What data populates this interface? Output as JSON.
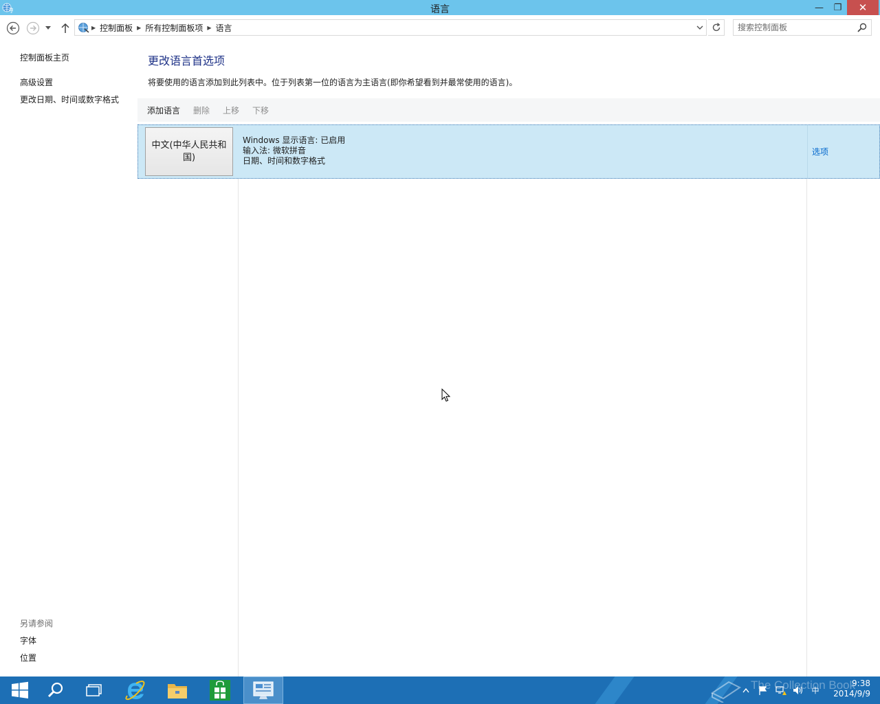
{
  "window": {
    "title": "语言",
    "minimize_glyph": "—",
    "maximize_glyph": "❐",
    "close_glyph": "✕"
  },
  "address_bar": {
    "breadcrumbs": [
      "控制面板",
      "所有控制面板项",
      "语言"
    ],
    "search_placeholder": "搜索控制面板"
  },
  "sidebar": {
    "home_link": "控制面板主页",
    "links": [
      "高级设置",
      "更改日期、时间或数字格式"
    ],
    "see_also_heading": "另请参阅",
    "see_also_links": [
      "字体",
      "位置"
    ]
  },
  "main": {
    "heading": "更改语言首选项",
    "description": "将要使用的语言添加到此列表中。位于列表第一位的语言为主语言(即你希望看到并最常使用的语言)。",
    "toolbar": {
      "add": "添加语言",
      "remove": "删除",
      "move_up": "上移",
      "move_down": "下移"
    },
    "languages": [
      {
        "name": "中文(中华人民共和国)",
        "details": [
          "Windows 显示语言: 已启用",
          "输入法: 微软拼音",
          "日期、时间和数字格式"
        ],
        "options_link": "选项"
      }
    ]
  },
  "taskbar": {
    "pinned": [
      "start-icon",
      "search-icon",
      "task-view-icon",
      "internet-explorer-icon",
      "file-explorer-icon",
      "store-icon",
      "control-panel-icon"
    ],
    "active": "control-panel-icon",
    "ime_indicator": "中",
    "clock_time": "9:38",
    "clock_date": "2014/9/9",
    "watermark": "The Collection Book"
  },
  "colors": {
    "titlebar": "#6cc4ec",
    "taskbar": "#1d6fb5",
    "selection": "#cce8f6",
    "heading": "#1e3287",
    "link": "#0066cc"
  }
}
